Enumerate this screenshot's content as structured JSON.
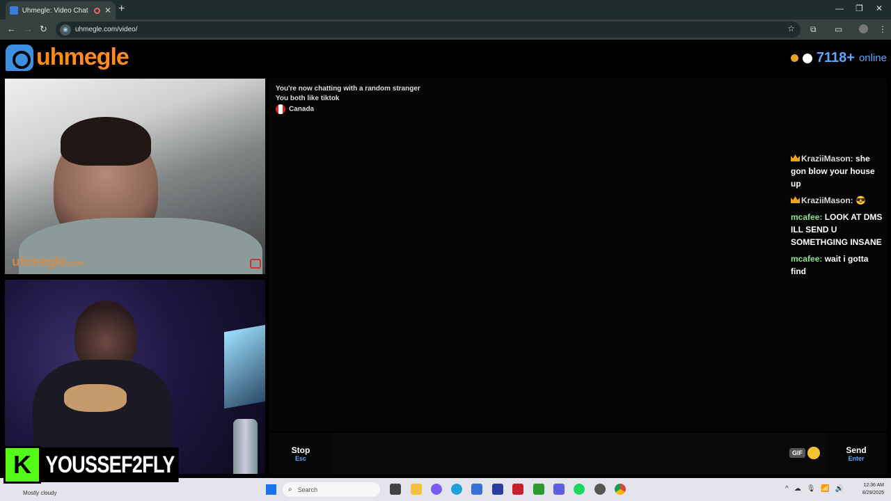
{
  "browser": {
    "tab_title": "Uhmegle: Video Chat | Om",
    "url": "uhmegle.com/video/"
  },
  "site": {
    "logo_text": "uhmegle",
    "online_count": "7118+",
    "online_label": "online"
  },
  "video": {
    "watermark_main": "uhmegle",
    "watermark_tld": ".com"
  },
  "chat": {
    "system_lines": [
      "You're now chatting with a random stranger",
      "You both like tiktok"
    ],
    "country": "Canada",
    "messages": [
      {
        "nick": "KraziiMason:",
        "text": "she gon blow your house up"
      },
      {
        "nick": "KraziiMason:",
        "text": "😎"
      },
      {
        "nick": "mcafee:",
        "text": "LOOK AT DMS ILL SEND U SOMETHGING INSANE"
      },
      {
        "nick": "mcafee:",
        "text": "wait i gotta find"
      }
    ]
  },
  "controls": {
    "stop_label": "Stop",
    "stop_key": "Esc",
    "gif_label": "GIF",
    "send_label": "Send",
    "send_key": "Enter"
  },
  "overlay": {
    "kick_letter": "K",
    "username": "YOUSSEF2FLY"
  },
  "taskbar": {
    "weather": "Mostly cloudy",
    "search_placeholder": "Search",
    "time": "12:36 AM",
    "date": "8/29/2025"
  },
  "colors": {
    "accent_blue": "#5aa8ff",
    "logo_orange": "#ff8a1f",
    "kick_green": "#53fc18"
  }
}
